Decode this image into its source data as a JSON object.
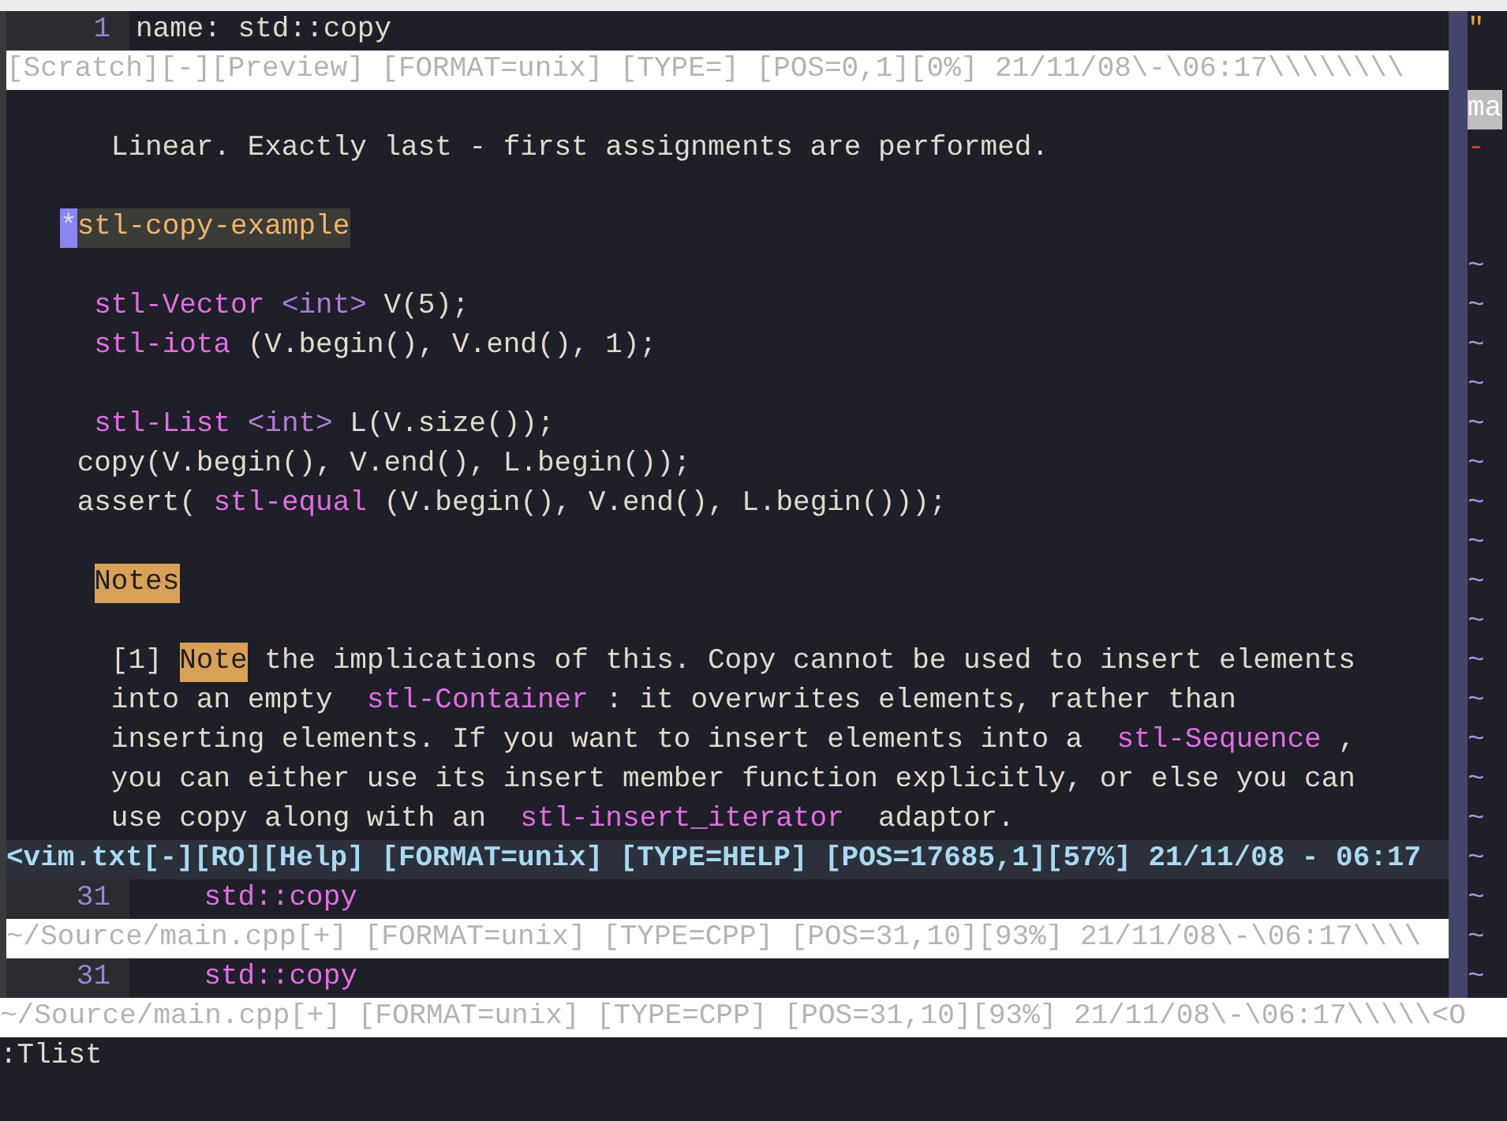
{
  "top_window": {
    "line_number": "1",
    "text": "name: std::copy",
    "status": "[Scratch][-][Preview] [FORMAT=unix] [TYPE=] [POS=0,1][0%] 21/11/08\\-\\06:17\\\\\\\\\\\\\\\\"
  },
  "help_window": {
    "lines": [
      {
        "kind": "blank"
      },
      {
        "kind": "text",
        "segments": [
          {
            "kind": "plain",
            "text": "   Linear. Exactly last - first assignments are performed."
          }
        ]
      },
      {
        "kind": "blank"
      },
      {
        "kind": "text",
        "segments": [
          {
            "kind": "star",
            "text": "*"
          },
          {
            "kind": "tag",
            "text": "stl-copy-example"
          }
        ]
      },
      {
        "kind": "blank"
      },
      {
        "kind": "text",
        "segments": [
          {
            "kind": "link",
            "text": "  stl-Vector "
          },
          {
            "kind": "type",
            "text": "<int>"
          },
          {
            "kind": "plain",
            "text": " V(5);"
          }
        ]
      },
      {
        "kind": "text",
        "segments": [
          {
            "kind": "link",
            "text": "  stl-iota"
          },
          {
            "kind": "plain",
            "text": " (V.begin(), V.end(), 1);"
          }
        ]
      },
      {
        "kind": "blank"
      },
      {
        "kind": "text",
        "segments": [
          {
            "kind": "link",
            "text": "  stl-List "
          },
          {
            "kind": "type",
            "text": "<int>"
          },
          {
            "kind": "plain",
            "text": " L(V.size());"
          }
        ]
      },
      {
        "kind": "text",
        "segments": [
          {
            "kind": "plain",
            "text": " copy(V.begin(), V.end(), L.begin());"
          }
        ]
      },
      {
        "kind": "text",
        "segments": [
          {
            "kind": "plain",
            "text": " assert( "
          },
          {
            "kind": "link",
            "text": "stl-equal"
          },
          {
            "kind": "plain",
            "text": " (V.begin(), V.end(), L.begin()));"
          }
        ]
      },
      {
        "kind": "blank"
      },
      {
        "kind": "text",
        "segments": [
          {
            "kind": "heading",
            "text": "  Notes"
          }
        ]
      },
      {
        "kind": "blank"
      },
      {
        "kind": "text",
        "segments": [
          {
            "kind": "plain",
            "text": "   [1] "
          },
          {
            "kind": "heading",
            "text": "Note"
          },
          {
            "kind": "plain",
            "text": " the implications of this. Copy cannot be used to insert elements"
          }
        ]
      },
      {
        "kind": "text",
        "segments": [
          {
            "kind": "plain",
            "text": "   into an empty  "
          },
          {
            "kind": "link",
            "text": "stl-Container"
          },
          {
            "kind": "plain",
            "text": " : it overwrites elements, rather than"
          }
        ]
      },
      {
        "kind": "text",
        "segments": [
          {
            "kind": "plain",
            "text": "   inserting elements. If you want to insert elements into a  "
          },
          {
            "kind": "link",
            "text": "stl-Sequence"
          },
          {
            "kind": "plain",
            "text": " ,"
          }
        ]
      },
      {
        "kind": "text",
        "segments": [
          {
            "kind": "plain",
            "text": "   you can either use its insert member function explicitly, or else you can"
          }
        ]
      },
      {
        "kind": "text",
        "segments": [
          {
            "kind": "plain",
            "text": "   use copy along with an  "
          },
          {
            "kind": "link",
            "text": "stl-insert_iterator"
          },
          {
            "kind": "plain",
            "text": "  adaptor."
          }
        ]
      }
    ],
    "status": "<vim.txt[-][RO][Help] [FORMAT=unix] [TYPE=HELP] [POS=17685,1][57%] 21/11/08 - 06:17"
  },
  "source_windows": [
    {
      "line_number": "31",
      "text": "    std::copy",
      "status": "~/Source/main.cpp[+] [FORMAT=unix] [TYPE=CPP] [POS=31,10][93%] 21/11/08\\-\\06:17\\\\\\\\"
    },
    {
      "line_number": "31",
      "text": "    std::copy",
      "status": "~/Source/main.cpp[+] [FORMAT=unix] [TYPE=CPP] [POS=31,10][93%] 21/11/08\\-\\06:17\\\\\\\\\\<O"
    }
  ],
  "side_pane": {
    "lines": [
      {
        "kind": "comment",
        "text": "\""
      },
      {
        "kind": "blank"
      },
      {
        "kind": "highlight",
        "text": "ma"
      },
      {
        "kind": "error",
        "text": "-"
      },
      {
        "kind": "blank"
      },
      {
        "kind": "blank"
      },
      {
        "kind": "tilde",
        "text": "~"
      },
      {
        "kind": "tilde",
        "text": "~"
      },
      {
        "kind": "tilde",
        "text": "~"
      },
      {
        "kind": "tilde",
        "text": "~"
      },
      {
        "kind": "tilde",
        "text": "~"
      },
      {
        "kind": "tilde",
        "text": "~"
      },
      {
        "kind": "tilde",
        "text": "~"
      },
      {
        "kind": "tilde",
        "text": "~"
      },
      {
        "kind": "tilde",
        "text": "~"
      },
      {
        "kind": "tilde",
        "text": "~"
      },
      {
        "kind": "tilde",
        "text": "~"
      },
      {
        "kind": "tilde",
        "text": "~"
      },
      {
        "kind": "tilde",
        "text": "~"
      },
      {
        "kind": "tilde",
        "text": "~"
      },
      {
        "kind": "tilde",
        "text": "~"
      },
      {
        "kind": "tilde",
        "text": "~"
      },
      {
        "kind": "tilde",
        "text": "~"
      },
      {
        "kind": "tilde",
        "text": "~"
      },
      {
        "kind": "tilde",
        "text": "~"
      }
    ]
  },
  "command_line": ":Tlist"
}
